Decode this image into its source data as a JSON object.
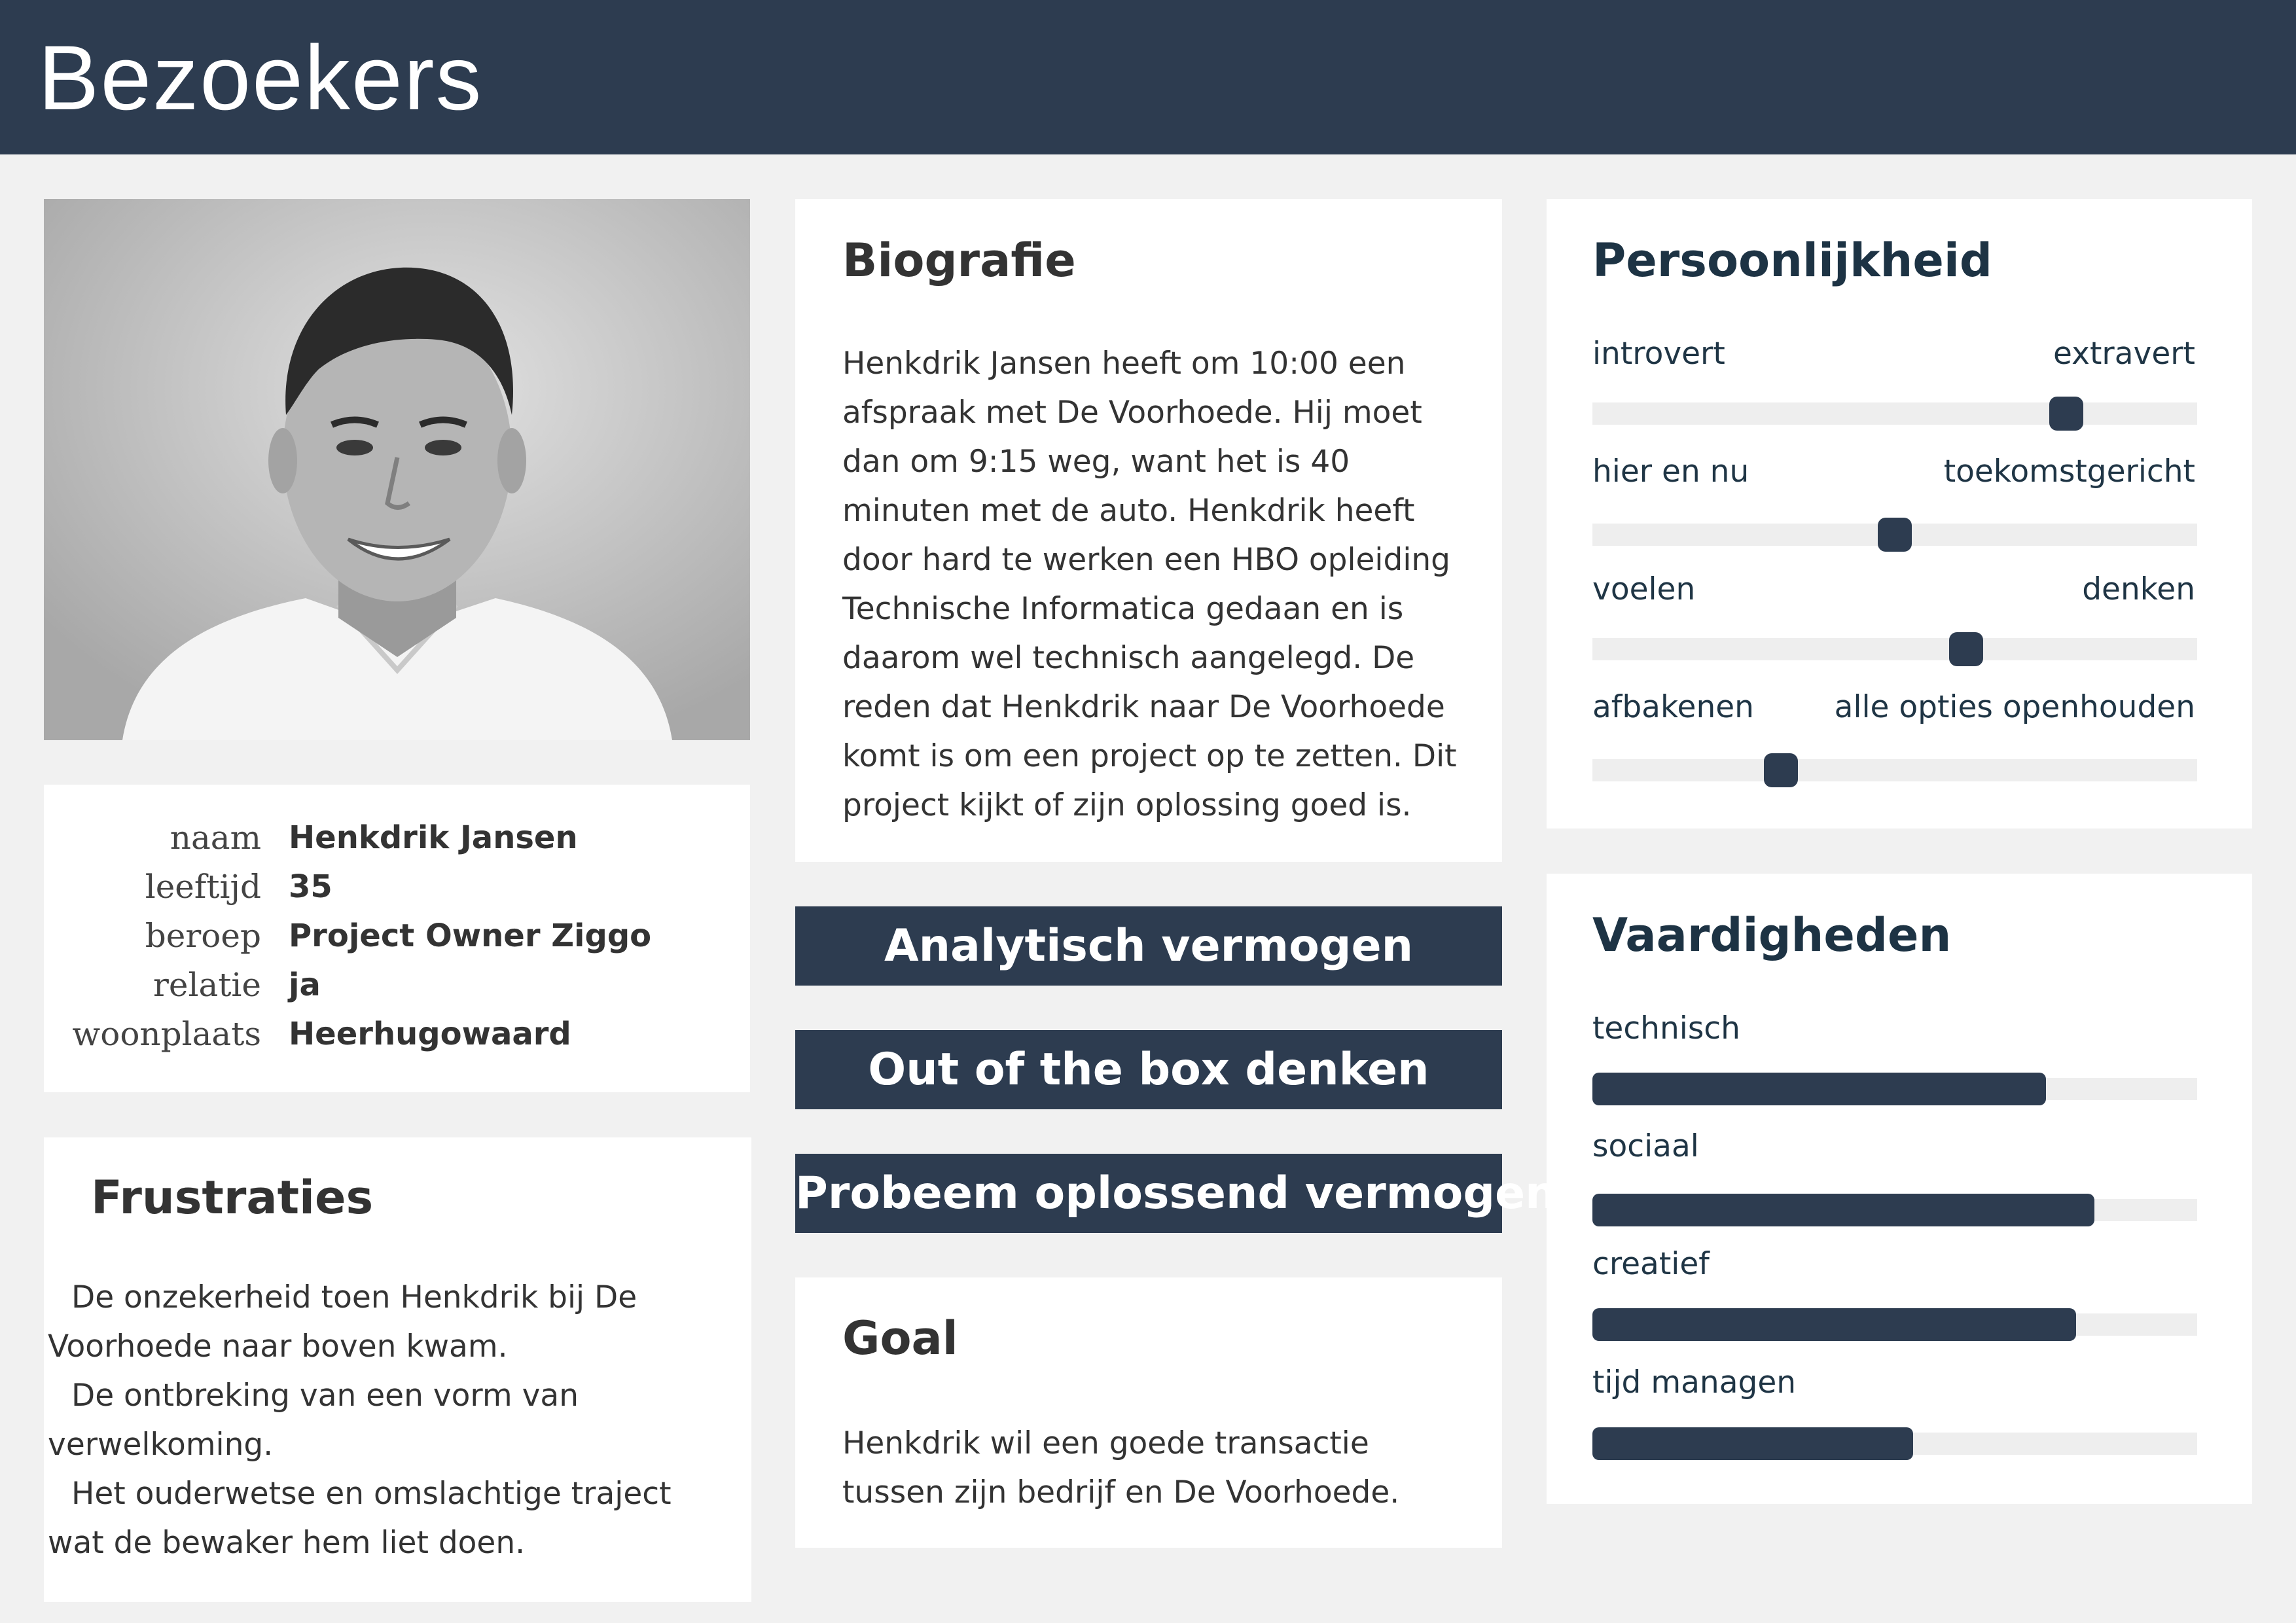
{
  "header": {
    "title": "Bezoekers"
  },
  "photo": {
    "alt": "Portret van Henkdrik Jansen"
  },
  "profile": {
    "rows": [
      {
        "label": "naam",
        "value": "Henkdrik Jansen"
      },
      {
        "label": "leeftijd",
        "value": "35"
      },
      {
        "label": "beroep",
        "value": "Project Owner Ziggo"
      },
      {
        "label": "relatie",
        "value": "ja"
      },
      {
        "label": "woonplaats",
        "value": "Heerhugowaard"
      }
    ]
  },
  "frustraties": {
    "title": "Frustraties",
    "items": [
      "De onzekerheid toen Henkdrik bij De Voorhoede naar boven kwam.",
      "De ontbreking van een vorm van verwelkoming.",
      "Het ouderwetse en omslachtige traject wat de bewaker hem liet doen."
    ]
  },
  "biografie": {
    "title": "Biografie",
    "text": "Henkdrik Jansen heeft om 10:00 een afspraak met De Voorhoede. Hij moet dan om 9:15 weg, want het is 40 minuten met de auto. Henkdrik heeft door hard te werken een HBO opleiding Technische Informatica gedaan en is daarom wel technisch aangelegd. De reden dat Henkdrik naar De Voorhoede komt is om een project op te zetten. Dit project kijkt of zijn oplossing goed is."
  },
  "traits": [
    "Analytisch vermogen",
    "Out of the box denken",
    "Probeem oplossend vermogen"
  ],
  "goal": {
    "title": "Goal",
    "text": "Henkdrik wil een goede transactie tussen zijn bedrijf en De Voorhoede."
  },
  "persoonlijkheid": {
    "title": "Persoonlijkheid",
    "sliders": [
      {
        "left": "introvert",
        "right": "extravert",
        "value": 0.8
      },
      {
        "left": "hier en nu",
        "right": "toekomstgericht",
        "value": 0.5
      },
      {
        "left": "voelen",
        "right": "denken",
        "value": 0.625
      },
      {
        "left": "afbakenen",
        "right": "alle opties openhouden",
        "value": 0.3
      }
    ]
  },
  "vaardigheden": {
    "title": "Vaardigheden",
    "skills": [
      {
        "label": "technisch",
        "value": 0.75
      },
      {
        "label": "sociaal",
        "value": 0.83
      },
      {
        "label": "creatief",
        "value": 0.8
      },
      {
        "label": "tijd managen",
        "value": 0.53
      }
    ]
  },
  "colors": {
    "header": "#2d3c50",
    "accent": "#2d3c50",
    "track": "#eeeeee",
    "background": "#f1f1f1"
  }
}
